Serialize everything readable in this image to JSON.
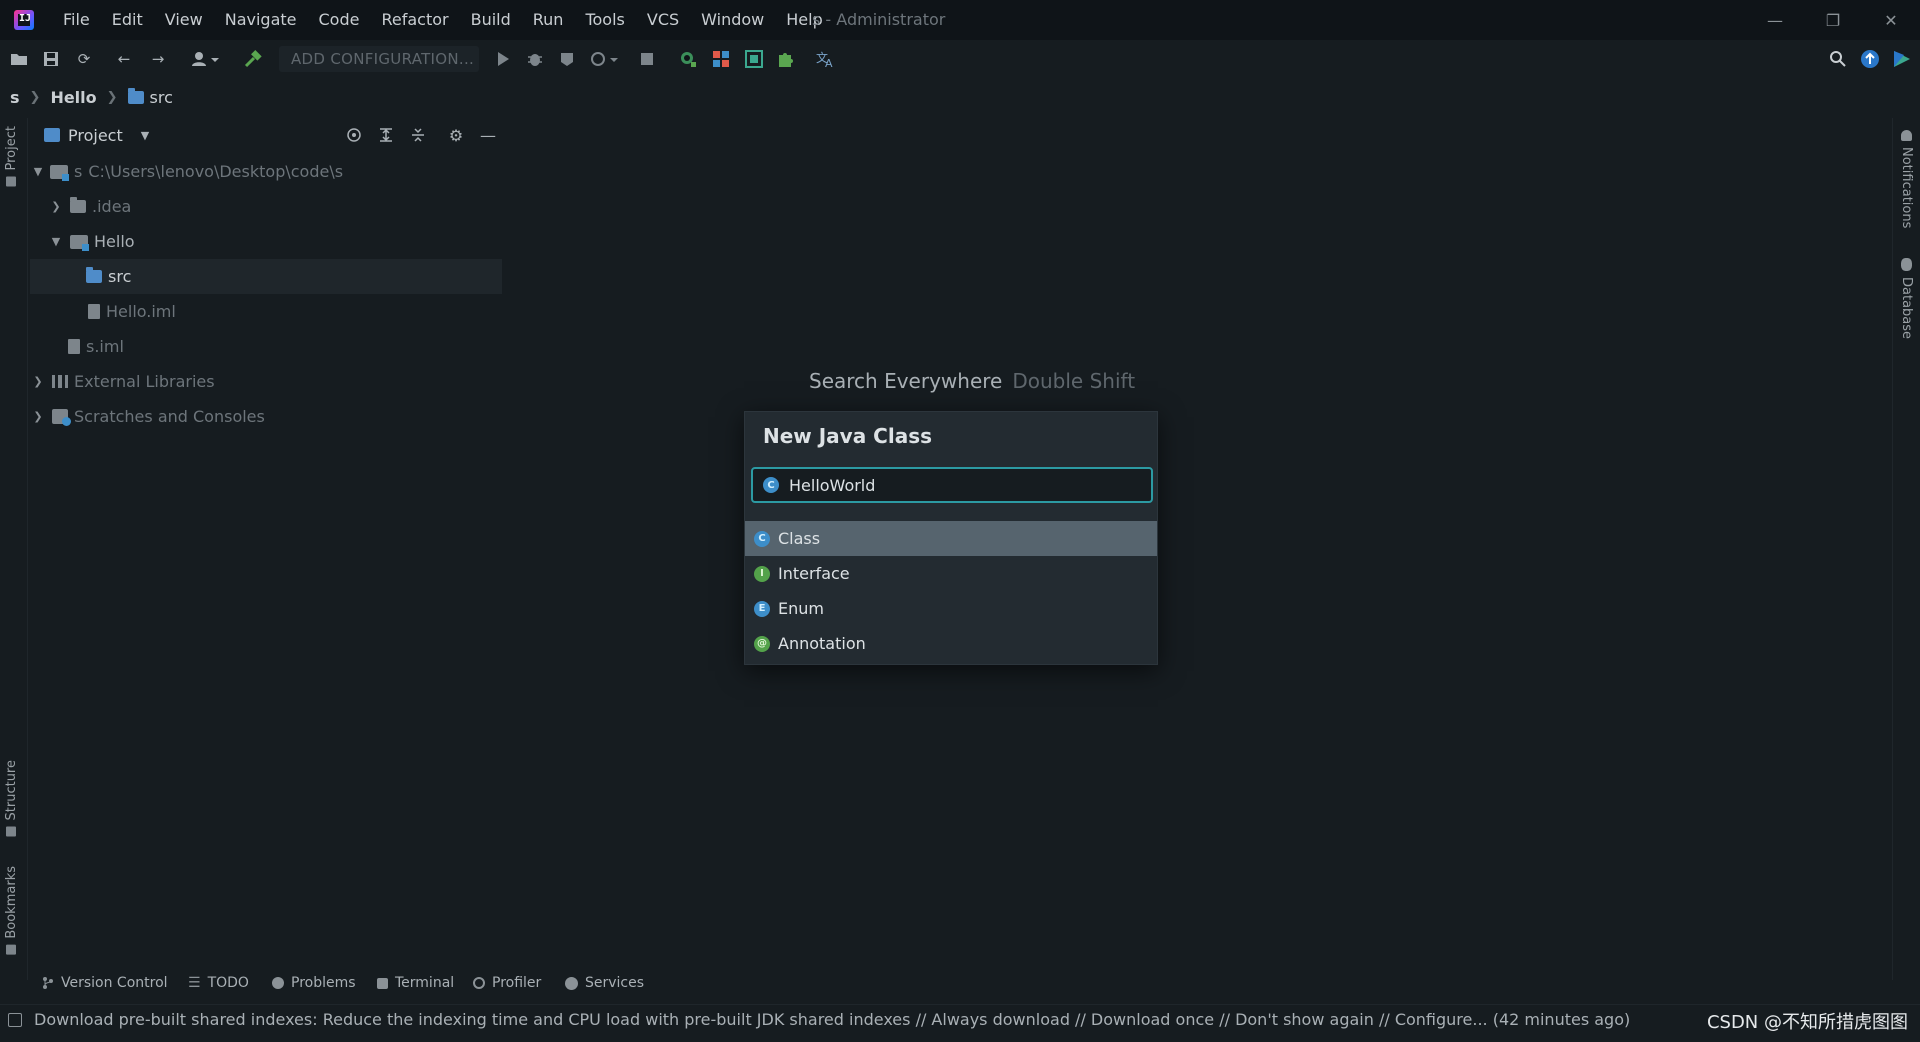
{
  "window": {
    "title": "s - Administrator",
    "logo_letters": "IJ",
    "controls": [
      "—",
      "❐",
      "✕"
    ]
  },
  "menu": [
    "File",
    "Edit",
    "View",
    "Navigate",
    "Code",
    "Refactor",
    "Build",
    "Run",
    "Tools",
    "VCS",
    "Window",
    "Help"
  ],
  "toolbar": {
    "config_label": "ADD CONFIGURATION...",
    "icons": [
      "open-folder",
      "save",
      "sync",
      "back",
      "forward",
      "user",
      "build-hammer",
      "run",
      "debug",
      "coverage",
      "profile",
      "stop",
      "plugin-a",
      "plugin-b",
      "plugin-c",
      "plugin-d",
      "translate",
      "search",
      "update",
      "toolbox"
    ]
  },
  "breadcrumb": {
    "root": "s",
    "module": "Hello",
    "folder": "src"
  },
  "project_panel": {
    "title": "Project",
    "tree": [
      {
        "label": "s",
        "path": "C:\\Users\\lenovo\\Desktop\\code\\s",
        "indent": 0,
        "expanded": true,
        "icon": "module"
      },
      {
        "label": ".idea",
        "indent": 1,
        "expanded": false,
        "icon": "folder"
      },
      {
        "label": "Hello",
        "indent": 1,
        "expanded": true,
        "icon": "module"
      },
      {
        "label": "src",
        "indent": 2,
        "icon": "source-folder",
        "selected": true
      },
      {
        "label": "Hello.iml",
        "indent": 2,
        "icon": "file"
      },
      {
        "label": "s.iml",
        "indent": 1,
        "icon": "file"
      },
      {
        "label": "External Libraries",
        "indent": 0,
        "expanded": false,
        "icon": "library"
      },
      {
        "label": "Scratches and Consoles",
        "indent": 0,
        "expanded": false,
        "icon": "scratch"
      }
    ]
  },
  "left_strip": {
    "tabs": [
      "Project",
      "Structure",
      "Bookmarks"
    ]
  },
  "right_strip": {
    "tabs": [
      "Notifications",
      "Database"
    ]
  },
  "editor": {
    "hint_label": "Search Everywhere",
    "hint_shortcut": "Double Shift"
  },
  "new_class_popup": {
    "title": "New Java Class",
    "input_value": "HelloWorld",
    "options": [
      {
        "label": "Class",
        "badge": "C",
        "active": true
      },
      {
        "label": "Interface",
        "badge": "I",
        "active": false
      },
      {
        "label": "Enum",
        "badge": "E",
        "active": false
      },
      {
        "label": "Annotation",
        "badge": "@",
        "active": false
      }
    ]
  },
  "bottom_tabs": [
    "Version Control",
    "TODO",
    "Problems",
    "Terminal",
    "Profiler",
    "Services"
  ],
  "status": {
    "message": "Download pre-built shared indexes: Reduce the indexing time and CPU load with pre-built JDK shared indexes // Always download // Download once // Don't show again // Configure... (42 minutes ago)",
    "watermark": "CSDN @不知所措虎图图"
  },
  "colors": {
    "background": "#161c20",
    "popup_bg": "#232b31",
    "input_border": "#2c9aa3",
    "selection": "#56646e",
    "class_icon": "#3d8ec9",
    "interface_icon": "#53a24a"
  }
}
